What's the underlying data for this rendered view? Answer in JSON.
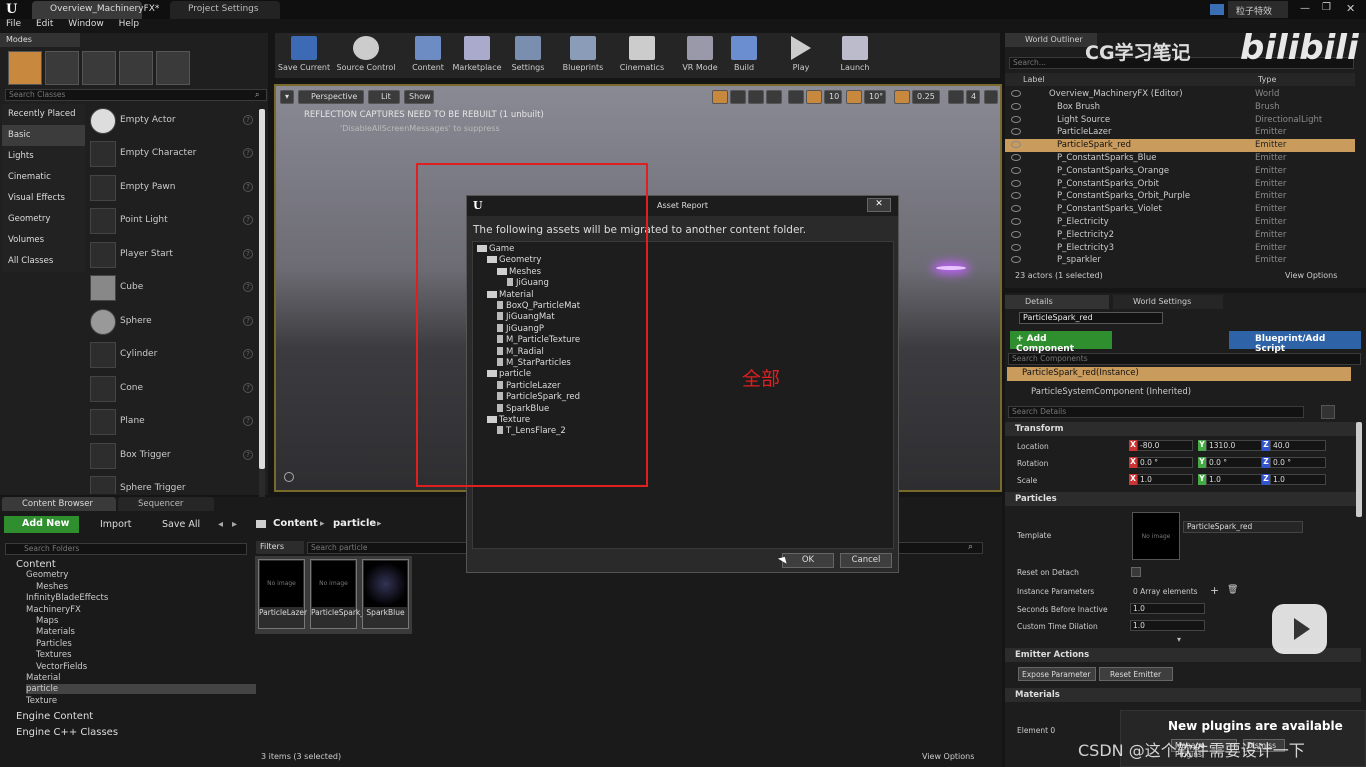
{
  "window": {
    "tabs": [
      "Overview_MachineryFX*",
      "Project Settings"
    ],
    "user": "粒子特效"
  },
  "menu": [
    "File",
    "Edit",
    "Window",
    "Help"
  ],
  "modes": {
    "title": "Modes",
    "search_placeholder": "Search Classes",
    "categories": [
      "Recently Placed",
      "Basic",
      "Lights",
      "Cinematic",
      "Visual Effects",
      "Geometry",
      "Volumes",
      "All Classes"
    ],
    "items": [
      "Empty Actor",
      "Empty Character",
      "Empty Pawn",
      "Point Light",
      "Player Start",
      "Cube",
      "Sphere",
      "Cylinder",
      "Cone",
      "Plane",
      "Box Trigger",
      "Sphere Trigger"
    ]
  },
  "toolbar": [
    "Save Current",
    "Source Control",
    "Content",
    "Marketplace",
    "Settings",
    "Blueprints",
    "Cinematics",
    "VR Mode",
    "Build",
    "Play",
    "Launch"
  ],
  "viewport": {
    "buttons": [
      "Perspective",
      "Lit",
      "Show"
    ],
    "grid": "10",
    "angle": "10°",
    "scale": "0.25",
    "cam": "4",
    "warning": "REFLECTION CAPTURES NEED TO BE REBUILT (1 unbuilt)",
    "suppress": "'DisableAllScreenMessages' to suppress"
  },
  "dialog": {
    "title": "Asset Report",
    "message": "The following assets will be migrated to another content folder.",
    "tree": [
      {
        "label": "Game",
        "kind": "folder",
        "depth": 0
      },
      {
        "label": "Geometry",
        "kind": "folder",
        "depth": 1
      },
      {
        "label": "Meshes",
        "kind": "folder",
        "depth": 2
      },
      {
        "label": "JiGuang",
        "kind": "file",
        "depth": 3
      },
      {
        "label": "Material",
        "kind": "folder",
        "depth": 1
      },
      {
        "label": "BoxQ_ParticleMat",
        "kind": "file",
        "depth": 2
      },
      {
        "label": "JiGuangMat",
        "kind": "file",
        "depth": 2
      },
      {
        "label": "JiGuangP",
        "kind": "file",
        "depth": 2
      },
      {
        "label": "M_ParticleTexture",
        "kind": "file",
        "depth": 2
      },
      {
        "label": "M_Radial",
        "kind": "file",
        "depth": 2
      },
      {
        "label": "M_StarParticles",
        "kind": "file",
        "depth": 2
      },
      {
        "label": "particle",
        "kind": "folder",
        "depth": 1
      },
      {
        "label": "ParticleLazer",
        "kind": "file",
        "depth": 2
      },
      {
        "label": "ParticleSpark_red",
        "kind": "file",
        "depth": 2
      },
      {
        "label": "SparkBlue",
        "kind": "file",
        "depth": 2
      },
      {
        "label": "Texture",
        "kind": "folder",
        "depth": 1
      },
      {
        "label": "T_LensFlare_2",
        "kind": "file",
        "depth": 2
      }
    ],
    "ok": "OK",
    "cancel": "Cancel"
  },
  "annotation": "全部",
  "content_browser": {
    "tabs": [
      "Content Browser",
      "Sequencer"
    ],
    "add_new": "Add New",
    "import": "Import",
    "save_all": "Save All",
    "path": [
      "Content",
      "particle"
    ],
    "search_folders": "Search Folders",
    "filters": "Filters",
    "search_assets": "Search particle",
    "folders": [
      {
        "label": "Content",
        "depth": 0
      },
      {
        "label": "Geometry",
        "depth": 1
      },
      {
        "label": "Meshes",
        "depth": 2
      },
      {
        "label": "InfinityBladeEffects",
        "depth": 1
      },
      {
        "label": "MachineryFX",
        "depth": 1
      },
      {
        "label": "Maps",
        "depth": 2
      },
      {
        "label": "Materials",
        "depth": 2
      },
      {
        "label": "Particles",
        "depth": 2
      },
      {
        "label": "Textures",
        "depth": 2
      },
      {
        "label": "VectorFields",
        "depth": 2
      },
      {
        "label": "Material",
        "depth": 1
      },
      {
        "label": "particle",
        "depth": 1
      },
      {
        "label": "Texture",
        "depth": 1
      },
      {
        "label": "Engine Content",
        "depth": 0
      },
      {
        "label": "Engine C++ Classes",
        "depth": 0
      }
    ],
    "assets": [
      "ParticleLazer",
      "ParticleSpark_red",
      "SparkBlue"
    ],
    "asset_thumb": "No image",
    "status": "3 items (3 selected)",
    "view_options": "View Options"
  },
  "outliner": {
    "title": "World Outliner",
    "search": "Search...",
    "col_label": "Label",
    "col_type": "Type",
    "rows": [
      {
        "label": "Overview_MachineryFX (Editor)",
        "type": "World"
      },
      {
        "label": "Box Brush",
        "type": "Brush"
      },
      {
        "label": "Light Source",
        "type": "DirectionalLight"
      },
      {
        "label": "ParticleLazer",
        "type": "Emitter"
      },
      {
        "label": "ParticleSpark_red",
        "type": "Emitter"
      },
      {
        "label": "P_ConstantSparks_Blue",
        "type": "Emitter"
      },
      {
        "label": "P_ConstantSparks_Orange",
        "type": "Emitter"
      },
      {
        "label": "P_ConstantSparks_Orbit",
        "type": "Emitter"
      },
      {
        "label": "P_ConstantSparks_Orbit_Purple",
        "type": "Emitter"
      },
      {
        "label": "P_ConstantSparks_Violet",
        "type": "Emitter"
      },
      {
        "label": "P_Electricity",
        "type": "Emitter"
      },
      {
        "label": "P_Electricity2",
        "type": "Emitter"
      },
      {
        "label": "P_Electricity3",
        "type": "Emitter"
      },
      {
        "label": "P_sparkler",
        "type": "Emitter"
      }
    ],
    "status": "23 actors (1 selected)",
    "view_options": "View Options"
  },
  "details": {
    "tabs": [
      "Details",
      "World Settings"
    ],
    "name": "ParticleSpark_red",
    "add_component": "+ Add Component",
    "blueprint": "Blueprint/Add Script",
    "search_components": "Search Components",
    "component_instance": "ParticleSpark_red(Instance)",
    "component_inherited": "ParticleSystemComponent (Inherited)",
    "search_details": "Search Details",
    "transform": "Transform",
    "location_label": "Location",
    "location": [
      "-80.0",
      "1310.0",
      "40.0"
    ],
    "rotation_label": "Rotation",
    "rotation": [
      "0.0 °",
      "0.0 °",
      "0.0 °"
    ],
    "scale_label": "Scale",
    "scale": [
      "1.0",
      "1.0",
      "1.0"
    ],
    "particles": "Particles",
    "template_label": "Template",
    "template_value": "ParticleSpark_red",
    "template_thumb": "No image",
    "reset_on_detach": "Reset on Detach",
    "instance_params": "Instance Parameters",
    "instance_params_value": "0 Array elements",
    "seconds_before_inactive": "Seconds Before Inactive",
    "seconds_value": "1.0",
    "custom_time_dilation": "Custom Time Dilation",
    "dilation_value": "1.0",
    "emitter_actions": "Emitter Actions",
    "expose_parameter": "Expose Parameter",
    "reset_emitter": "Reset Emitter",
    "materials": "Materials",
    "element0": "Element 0"
  },
  "notification": {
    "title": "New plugins are available",
    "link": "Manage Plugins",
    "dismiss": "Dismiss"
  },
  "watermarks": {
    "cg": "CG学习笔记",
    "bili": "bilibili",
    "csdn": "CSDN @这个软件需要设计一下"
  }
}
